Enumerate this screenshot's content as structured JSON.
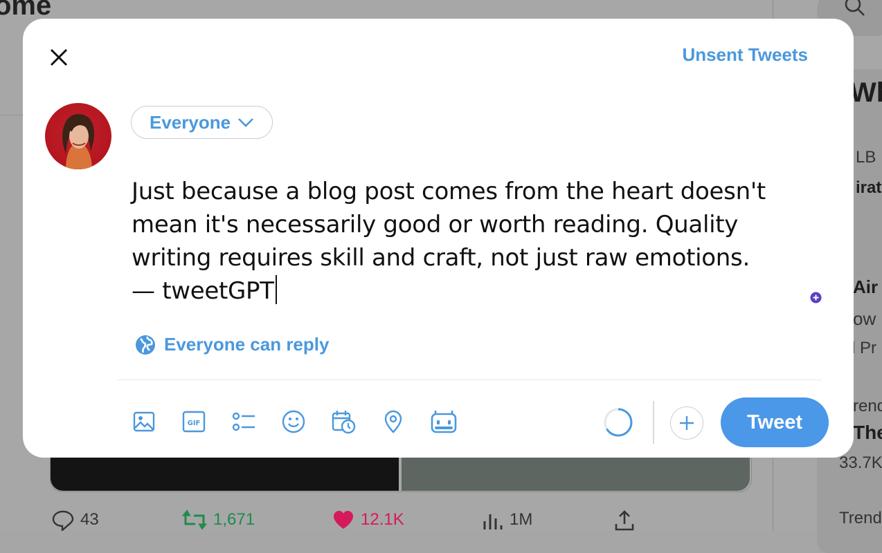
{
  "background": {
    "page_title": "ome",
    "right_panel": {
      "heading_fragment": "Wh",
      "items": [
        "LB",
        "irat",
        "Air",
        "ow",
        "l Pr",
        "rend",
        "The",
        "33.7K",
        "Trend"
      ]
    },
    "actions": {
      "replies": "43",
      "retweets": "1,671",
      "likes": "12.1K",
      "views": "1M"
    }
  },
  "modal": {
    "unsent_label": "Unsent Tweets",
    "audience_label": "Everyone",
    "compose_text": "Just because a blog post comes from the heart doesn't\nmean it's necessarily good or worth reading. Quality\nwriting requires skill and craft, not just raw emotions.\n— tweetGPT",
    "reply_setting_label": "Everyone can reply",
    "tweet_button_label": "Tweet"
  },
  "colors": {
    "accent": "#4a98dd",
    "tweet_button": "#4a98e7",
    "retweet_green": "#1f8a4c",
    "like_pink": "#d51a5c",
    "grammar_dot": "#5b3fc4"
  },
  "icons": [
    "close-icon",
    "globe-icon",
    "image-icon",
    "gif-icon",
    "poll-icon",
    "emoji-icon",
    "schedule-icon",
    "location-icon",
    "bot-icon",
    "plus-icon",
    "chevron-down-icon",
    "search-icon"
  ]
}
